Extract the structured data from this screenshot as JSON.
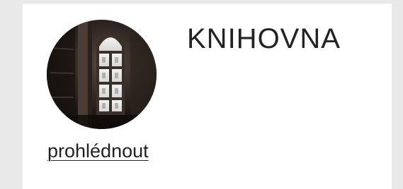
{
  "card": {
    "title": "KNIHOVNA",
    "link_label": "prohlédnout",
    "image_icon": "library-window-photo"
  },
  "colors": {
    "page_background": "#e9e9e9",
    "card_background": "#ffffff",
    "text": "#222222"
  }
}
